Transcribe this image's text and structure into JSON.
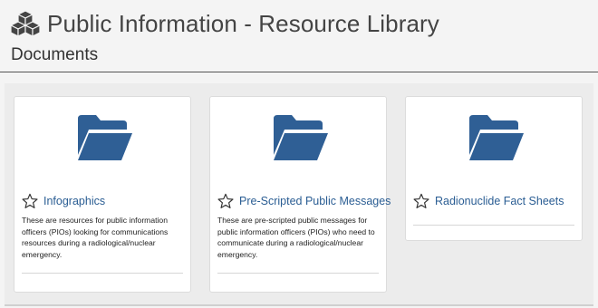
{
  "header": {
    "icon": "cubes-icon",
    "title": "Public Information - Resource Library"
  },
  "section": {
    "title": "Documents"
  },
  "colors": {
    "link": "#2a5d93",
    "folder": "#2f5f95"
  },
  "cards": [
    {
      "icon": "folder-open-icon",
      "favorite_icon": "star-outline-icon",
      "title": "Infographics",
      "description": "These are resources for public information officers (PIOs) looking for communications resources during a radiological/nuclear emergency."
    },
    {
      "icon": "folder-open-icon",
      "favorite_icon": "star-outline-icon",
      "title": "Pre-Scripted Public Messages",
      "description": "These are pre-scripted public messages for public information officers (PIOs) who need to communicate during a radiological/nuclear emergency."
    },
    {
      "icon": "folder-open-icon",
      "favorite_icon": "star-outline-icon",
      "title": "Radionuclide Fact Sheets",
      "description": ""
    }
  ]
}
